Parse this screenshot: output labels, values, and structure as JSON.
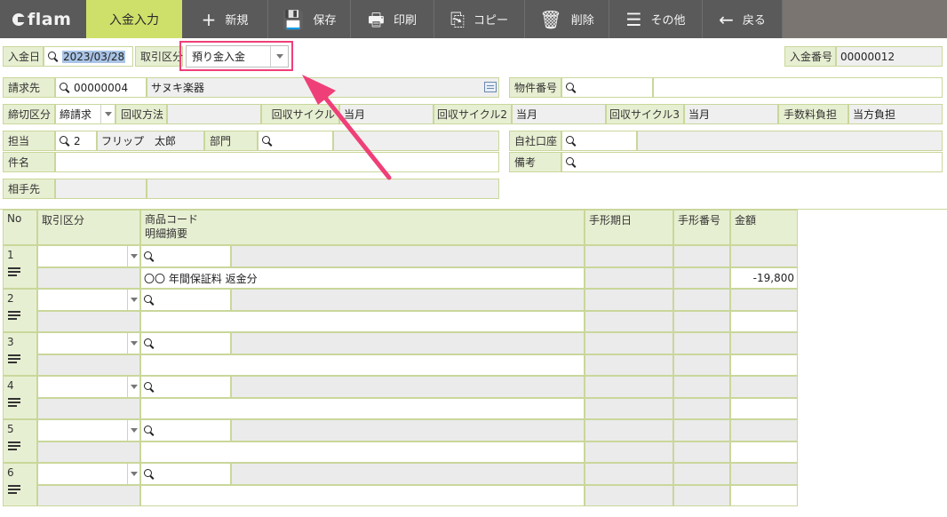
{
  "toolbar": {
    "logo": "flam",
    "active_tab": "入金入力",
    "buttons": [
      {
        "label": "新規",
        "icon": "plus-icon",
        "glyph": "+"
      },
      {
        "label": "保存",
        "icon": "save-icon",
        "glyph": "💾"
      },
      {
        "label": "印刷",
        "icon": "print-icon",
        "glyph": "🖶"
      },
      {
        "label": "コピー",
        "icon": "copy-icon",
        "glyph": "⎘"
      },
      {
        "label": "削除",
        "icon": "trash-icon",
        "glyph": "🗑"
      },
      {
        "label": "その他",
        "icon": "menu-icon",
        "glyph": "☰"
      },
      {
        "label": "戻る",
        "icon": "back-arrow-icon",
        "glyph": "←"
      }
    ]
  },
  "header": {
    "deposit_date_label": "入金日",
    "deposit_date": "2023/03/28",
    "transaction_type_label": "取引区分",
    "transaction_type": "預り金入金",
    "deposit_number_label": "入金番号",
    "deposit_number": "00000012",
    "billing_label": "請求先",
    "billing_code": "00000004",
    "billing_name": "サヌキ楽器",
    "property_number_label": "物件番号",
    "cutoff_label": "締切区分",
    "cutoff_value": "締請求",
    "collection_method_label": "回収方法",
    "cycle1_label": "回収サイクル",
    "cycle1_value": "当月",
    "cycle2_label": "回収サイクル2",
    "cycle2_value": "当月",
    "cycle3_label": "回収サイクル3",
    "cycle3_value": "当月",
    "fee_label": "手数料負担",
    "fee_value": "当方負担",
    "staff_label": "担当",
    "staff_code": "2",
    "staff_name": "フリップ　太郎",
    "dept_label": "部門",
    "own_account_label": "自社口座",
    "subject_label": "件名",
    "remarks_label": "備考",
    "counterparty_label": "相手先"
  },
  "grid": {
    "headers": {
      "no": "No",
      "type": "取引区分",
      "product_code": "商品コード",
      "detail_summary": "明細摘要",
      "bill_due": "手形期日",
      "bill_number": "手形番号",
      "amount": "金額"
    },
    "rows": [
      {
        "no": "1",
        "summary": "〇〇 年間保証料 返金分",
        "amount": "-19,800"
      },
      {
        "no": "2",
        "summary": "",
        "amount": ""
      },
      {
        "no": "3",
        "summary": "",
        "amount": ""
      },
      {
        "no": "4",
        "summary": "",
        "amount": ""
      },
      {
        "no": "5",
        "summary": "",
        "amount": ""
      },
      {
        "no": "6",
        "summary": "",
        "amount": ""
      }
    ]
  },
  "colors": {
    "toolbar_bg": "#5a5a5a",
    "active_tab_bg": "#cfe06a",
    "label_bg": "#e7efd2",
    "highlight": "#ef3f78"
  }
}
